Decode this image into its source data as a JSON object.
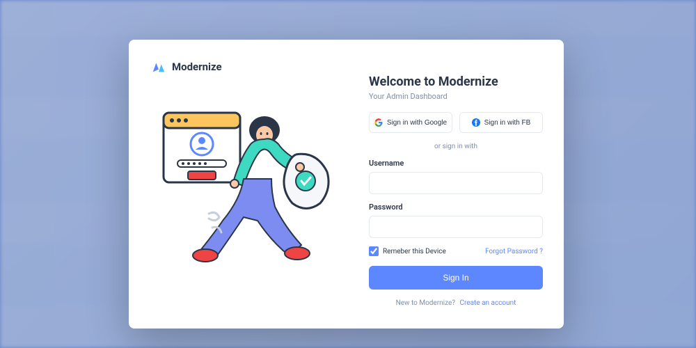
{
  "brand": {
    "name": "Modernize"
  },
  "heading": {
    "title": "Welcome to Modernize",
    "subtitle": "Your Admin Dashboard"
  },
  "social": {
    "google": "Sign in with Google",
    "facebook": "Sign in with FB"
  },
  "divider": "or sign in with",
  "fields": {
    "username": {
      "label": "Username",
      "value": ""
    },
    "password": {
      "label": "Password",
      "value": ""
    }
  },
  "remember": {
    "label": "Remeber this Device",
    "checked": true
  },
  "forgot": "Forgot Password ?",
  "signin": "Sign In",
  "footer": {
    "text": "New to Modernize?",
    "link": "Create an account"
  }
}
